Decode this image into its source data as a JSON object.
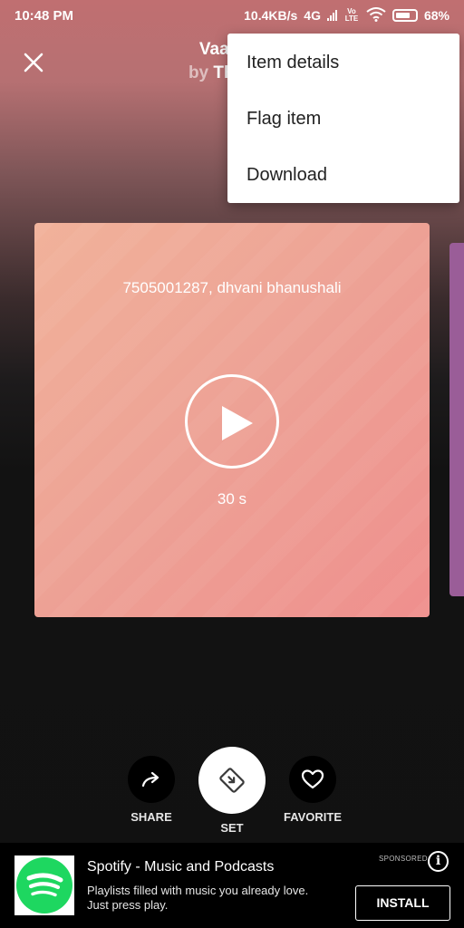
{
  "status_bar": {
    "time": "10:48 PM",
    "network_speed": "10.4KB/s",
    "network_type": "4G",
    "volte": "Vo LTE",
    "battery": "68%"
  },
  "header": {
    "title": "Vaaste",
    "by_prefix": "by",
    "author": "TheYo"
  },
  "menu": {
    "items": [
      {
        "label": "Item details"
      },
      {
        "label": "Flag item"
      },
      {
        "label": "Download"
      }
    ]
  },
  "card": {
    "name": "7505001287, dhvani bhanushali",
    "duration": "30 s"
  },
  "actions": {
    "share_label": "SHARE",
    "set_label": "SET",
    "favorite_label": "FAVORITE"
  },
  "ad": {
    "app_name": "Spotify - Music and Podcasts",
    "description": "Playlists filled with music you already love. Just press play.",
    "sponsored": "SPONSORED",
    "install_label": "INSTALL",
    "brand_color": "#1ed760"
  },
  "icons": [
    "close-icon",
    "play-icon",
    "share-icon",
    "set-ringtone-icon",
    "heart-icon",
    "spotify-logo",
    "info-icon"
  ]
}
